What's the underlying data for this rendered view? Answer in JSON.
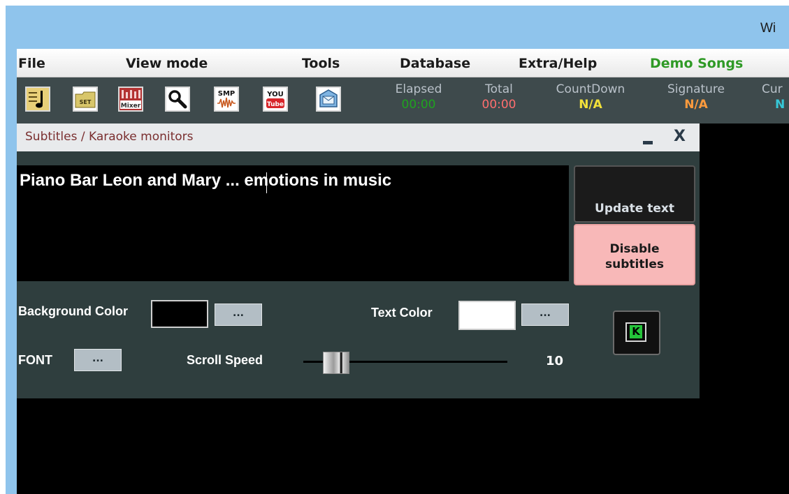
{
  "window": {
    "title": "Wi"
  },
  "menu": [
    "File",
    "View mode",
    "Tools",
    "Database",
    "Extra/Help",
    "Demo Songs"
  ],
  "colors": {
    "demo_songs": "#2f9a26",
    "elapsed": "#1fa31f",
    "total": "#ff6e6e",
    "countdown": "#f2e13a",
    "signature": "#ff9b3d",
    "current": "#36c8d8",
    "panel_bg": "#2f3e3e",
    "disable_bg": "#f8b8b8"
  },
  "toolbar": {
    "icons": [
      "song-sheet-icon",
      "set-icon",
      "mixer-icon",
      "search-icon",
      "smp-icon",
      "youtube-icon",
      "monitor-icon"
    ],
    "icon_text": {
      "set": "SET",
      "mixer": "Mixer",
      "smp": "SMP",
      "youtube_top": "YOU",
      "youtube_bottom": "Tube"
    },
    "stats": [
      {
        "label": "Elapsed",
        "value": "00:00"
      },
      {
        "label": "Total",
        "value": "00:00"
      },
      {
        "label": "CountDown",
        "value": "N/A"
      },
      {
        "label": "Signature",
        "value": "N/A"
      },
      {
        "label": "Cur",
        "value": "N"
      }
    ]
  },
  "panel": {
    "title": "Subtitles / Karaoke monitors",
    "close": "X",
    "subtitle_text": "Piano Bar Leon and Mary ... emotions in music",
    "update_button": "Update text",
    "disable_button_line1": "Disable",
    "disable_button_line2": "subtitles",
    "background_color_label": "Background Color",
    "background_color_value": "#000000",
    "text_color_label": "Text Color",
    "text_color_value": "#ffffff",
    "font_label": "FONT",
    "dots": "...",
    "scroll_speed_label": "Scroll Speed",
    "scroll_speed_value": "10",
    "scroll_speed_fraction": 0.16
  }
}
